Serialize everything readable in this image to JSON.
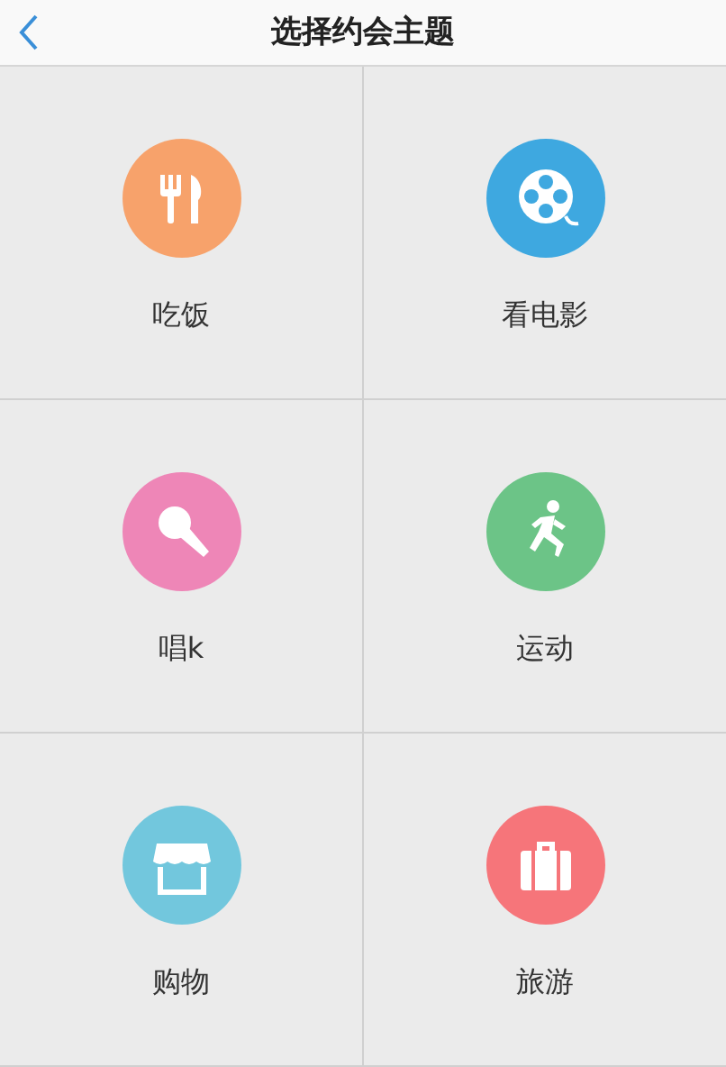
{
  "header": {
    "title": "选择约会主题"
  },
  "themes": [
    {
      "label": "吃饭",
      "kind": "food",
      "color": "#f7a26b"
    },
    {
      "label": "看电影",
      "kind": "film",
      "color": "#3ea8e0"
    },
    {
      "label": "唱k",
      "kind": "mic",
      "color": "#ee86b7"
    },
    {
      "label": "运动",
      "kind": "sport",
      "color": "#6cc487"
    },
    {
      "label": "购物",
      "kind": "shop",
      "color": "#72c7dd"
    },
    {
      "label": "旅游",
      "kind": "travel",
      "color": "#f6757a"
    }
  ]
}
